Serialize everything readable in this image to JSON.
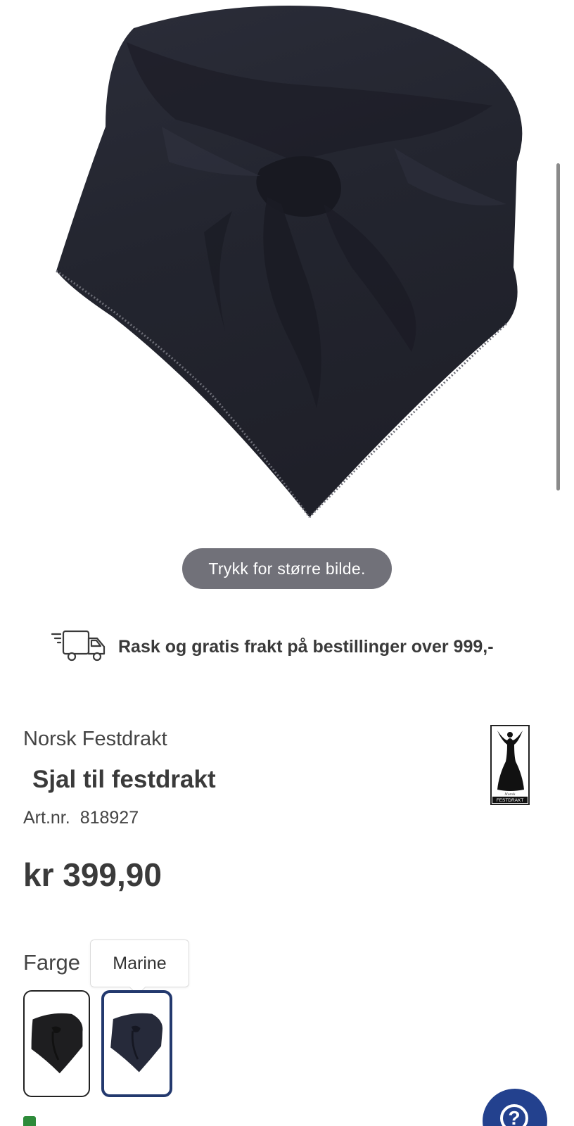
{
  "product_image": {
    "alt": "Sjal til festdrakt – Marine"
  },
  "zoom_hint": "Trykk for større bilde.",
  "shipping": {
    "icon": "delivery-truck-icon",
    "text": "Rask og gratis frakt på bestillinger over 999,-"
  },
  "product": {
    "brand": "Norsk Festdrakt",
    "title": "Sjal til festdrakt",
    "art_label": "Art.nr.",
    "art_number": "818927",
    "price": "kr 399,90"
  },
  "brand_logo": {
    "icon": "norsk-festdrakt-logo",
    "small_text": "Norsk",
    "text": "FESTDRAKT"
  },
  "color_picker": {
    "label": "Farge",
    "selected_tooltip": "Marine",
    "options": [
      {
        "name": "black",
        "color": "#1e1e20",
        "selected": false
      },
      {
        "name": "Marine",
        "color": "#262a3a",
        "selected": true
      }
    ],
    "selected_border": "#23396e"
  },
  "help_button": {
    "icon": "question-mark-icon",
    "symbol": "?",
    "color": "#23418e"
  }
}
